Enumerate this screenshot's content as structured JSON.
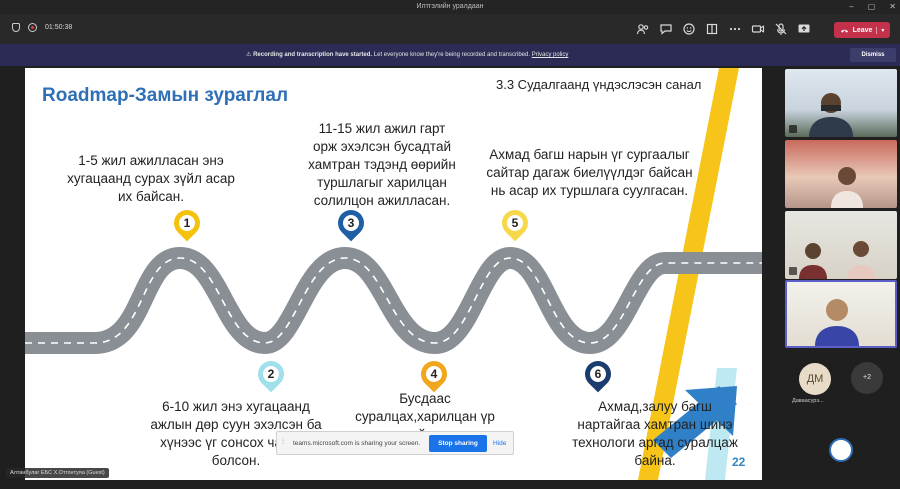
{
  "window": {
    "title": "Илтгэлийн уралдаан",
    "minimize": "–",
    "maximize": "▢",
    "close": "✕"
  },
  "toolbar": {
    "timer": "01:50:38",
    "icons": [
      "people-icon",
      "chat-icon",
      "reactions-icon",
      "rooms-icon",
      "more-icon",
      "camera-icon",
      "mic-off-icon",
      "share-icon"
    ],
    "leave_label": "Leave",
    "leave_color": "#c4314b"
  },
  "banner": {
    "bold": "Recording and transcription have started.",
    "text": "Let everyone know they're being recorded and transcribed.",
    "link": "Privacy policy",
    "dismiss": "Dismiss",
    "bg_color": "#2b2b55"
  },
  "slide": {
    "title": "Roadmap-Замын зураглал",
    "subtitle": "3.3 Судалгаанд үндэслэсэн санал",
    "number": "22",
    "texts": [
      {
        "line1": "1-5 жил ажилласан энэ",
        "line2": "хугацаанд сурах зүйл асар",
        "line3": "их байсан."
      },
      {
        "line1": "6-10 жил энэ хугацаанд",
        "line2": "ажлын дөр суун эхэлсэн ба",
        "line3": "хүнээс үг сонсох чадвар",
        "line4": "болсон."
      },
      {
        "line1": "11-15 жил ажил гарт",
        "line2": "орж эхэлсэн бусадтай",
        "line3": "хамтран тэдэнд өөрийн",
        "line4": "туршлагыг харилцан",
        "line5": "солилцон ажилласан."
      },
      {
        "line1": "Бусдаас",
        "line2": "суралцах,харилцан үр",
        "line3": "өгөөжтэй хамтран"
      },
      {
        "line1": "Ахмад багш нарын үг сургаалыг",
        "line2": "сайтар дагаж биелүүлдэг байсан",
        "line3": "нь асар их туршлага суулгасан."
      },
      {
        "line1": "Ахмад,залуу багш",
        "line2": "нартайгаа хамтран шинэ",
        "line3": "технологи аргад суралцаж",
        "line4": "байна."
      }
    ],
    "pins": [
      {
        "label": "1",
        "color": "#f4c20d"
      },
      {
        "label": "2",
        "color": "#9fe0ec"
      },
      {
        "label": "3",
        "color": "#1f5fa6"
      },
      {
        "label": "4",
        "color": "#f0a71e"
      },
      {
        "label": "5",
        "color": "#f7d84a"
      },
      {
        "label": "6",
        "color": "#1a3c6e"
      }
    ],
    "road_color": "#8a8f95",
    "accent_yellow": "#f7c519",
    "accent_blue": "#2f80c7"
  },
  "sharebar": {
    "text": "teams.microsoft.com is sharing your screen.",
    "stop": "Stop sharing",
    "hide": "Hide"
  },
  "presenter": "Алтанбулаг ЕБС Х.Отгонтуяа (Guest)",
  "participants": {
    "initials": "ДМ",
    "name": "Даваасүрэ...",
    "more": "+2"
  }
}
